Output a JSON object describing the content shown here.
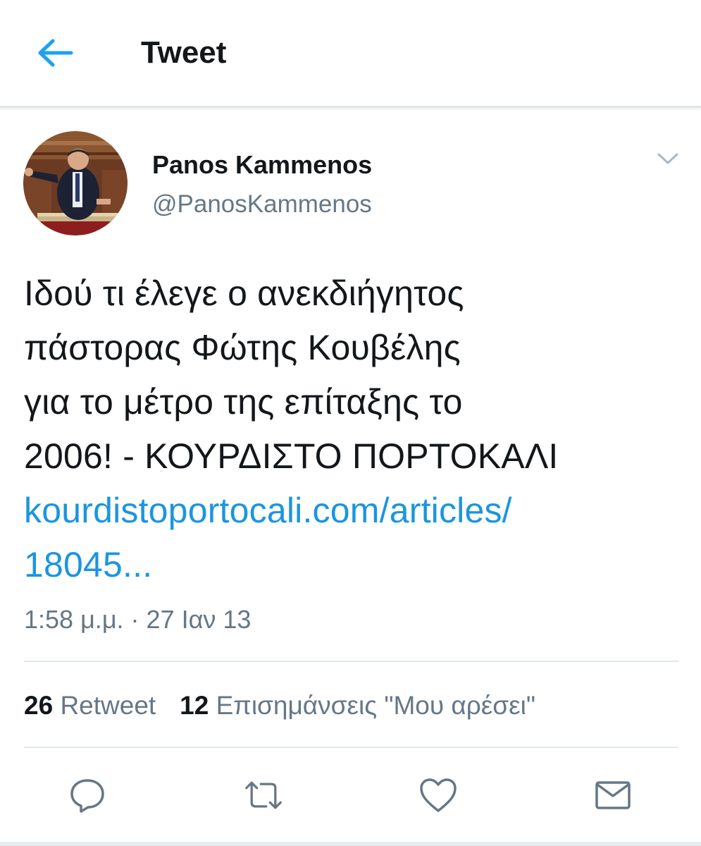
{
  "header": {
    "title": "Tweet",
    "back_icon": "arrow-left-icon"
  },
  "tweet": {
    "author": {
      "display_name": "Panos Kammenos",
      "handle": "@PanosKammenos"
    },
    "text_lines": [
      "Ιδού τι έλεγε ο ανεκδιήγητος",
      "πάστορας Φώτης Κουβέλης",
      "για το μέτρο της επίταξης το",
      "2006! - ΚΟΥΡΔΙΣΤΟ ΠΟΡΤΟΚΑΛΙ"
    ],
    "link_lines": [
      "kourdistoportocali.com/articles/",
      "18045..."
    ],
    "timestamp": "1:58 μ.μ. · 27 Ιαν 13"
  },
  "stats": {
    "retweets_count": "26",
    "retweets_label": "Retweet",
    "likes_count": "12",
    "likes_label": "Επισημάνσεις \"Μου αρέσει\""
  },
  "actions": [
    {
      "name": "reply",
      "icon": "reply-icon"
    },
    {
      "name": "retweet",
      "icon": "retweet-icon"
    },
    {
      "name": "like",
      "icon": "heart-icon"
    },
    {
      "name": "share",
      "icon": "envelope-icon"
    }
  ],
  "colors": {
    "accent": "#1da1f2",
    "link": "#1b95e0",
    "secondary_text": "#657786",
    "primary_text": "#14171a",
    "divider": "#e1e8ed"
  }
}
